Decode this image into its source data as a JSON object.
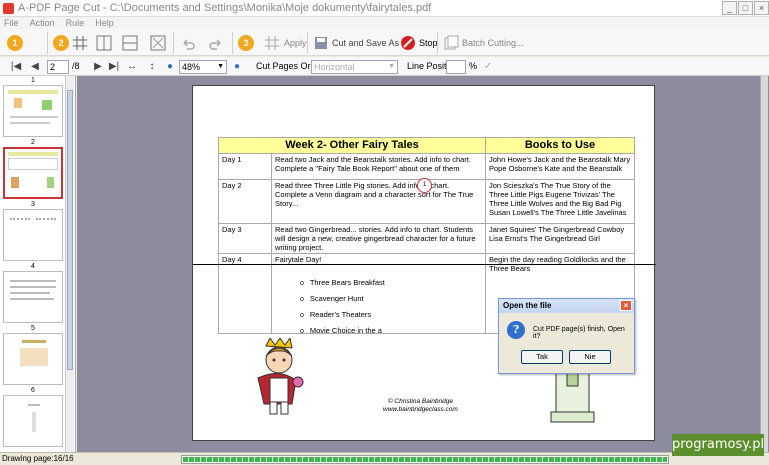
{
  "window": {
    "title": "A-PDF Page Cut - C:\\Documents and Settings\\Monika\\Moje dokumenty\\fairytales.pdf"
  },
  "menu": [
    "File",
    "Action",
    "Rule",
    "Help"
  ],
  "toolbar": {
    "apply_label": "Apply",
    "cut_save_label": "Cut and Save As",
    "stop_label": "Stop",
    "batch_label": "Batch Cutting..."
  },
  "nav": {
    "page_value": "2",
    "page_total": "/8",
    "zoom": "48%",
    "cut_order_label": "Cut Pages Order:",
    "cut_order_value": "Horizontal",
    "line_position_label": "Line Position:",
    "line_position_unit": "%"
  },
  "thumbnails": [
    {
      "num": "1"
    },
    {
      "num": "2"
    },
    {
      "num": "3"
    },
    {
      "num": "4"
    },
    {
      "num": "5"
    },
    {
      "num": "6"
    }
  ],
  "document": {
    "header_week": "Week 2- Other Fairy Tales",
    "header_books": "Books to Use",
    "rows": [
      {
        "day": "Day 1",
        "activity": "Read two Jack and the Beanstalk stories. Add info to chart. Complete a \"Fairy Tale Book Report\" about one of them",
        "books": "John Howe's Jack and the Beanstalk Mary Pope Osborne's Kate and the Beanstalk"
      },
      {
        "day": "Day 2",
        "activity": "Read three Three Little Pig stories. Add info to chart. Complete a Venn diagram and a character sort for The True Story...",
        "books": "Jon Scieszka's The True Story of the Three Little Pigs Eugene Trivizas' The Three Little Wolves and the Big Bad Pig Susan Lowell's The Three Little Javelinas"
      },
      {
        "day": "Day 3",
        "activity": "Read two Gingerbread... stories. Add info to chart. Students will design a new, creative gingerbread character for a future writing project.",
        "books": "Janet Squires' The Gingerbread Cowboy Lisa Ernst's The Gingerbread Girl"
      },
      {
        "day": "Day 4",
        "activity": "Fairytale Day!",
        "books": "Begin the day reading Goldilocks and the Three Bears"
      }
    ],
    "bullets": [
      "Three Bears Breakfast",
      "Scavenger Hunt",
      "Reader's Theaters",
      "Movie Choice in the a"
    ],
    "marker": "1",
    "credit_line1": "© Christina Bainbridge",
    "credit_line2": "www.bainbridgeclass.com"
  },
  "dialog": {
    "title": "Open the file",
    "message": "Cut PDF page(s) finish, Open it?",
    "yes_label": "Tak",
    "no_label": "Nie"
  },
  "status": {
    "text": "Drawing page:16/16",
    "progress": 1.0
  },
  "watermark": "programosy.pl"
}
